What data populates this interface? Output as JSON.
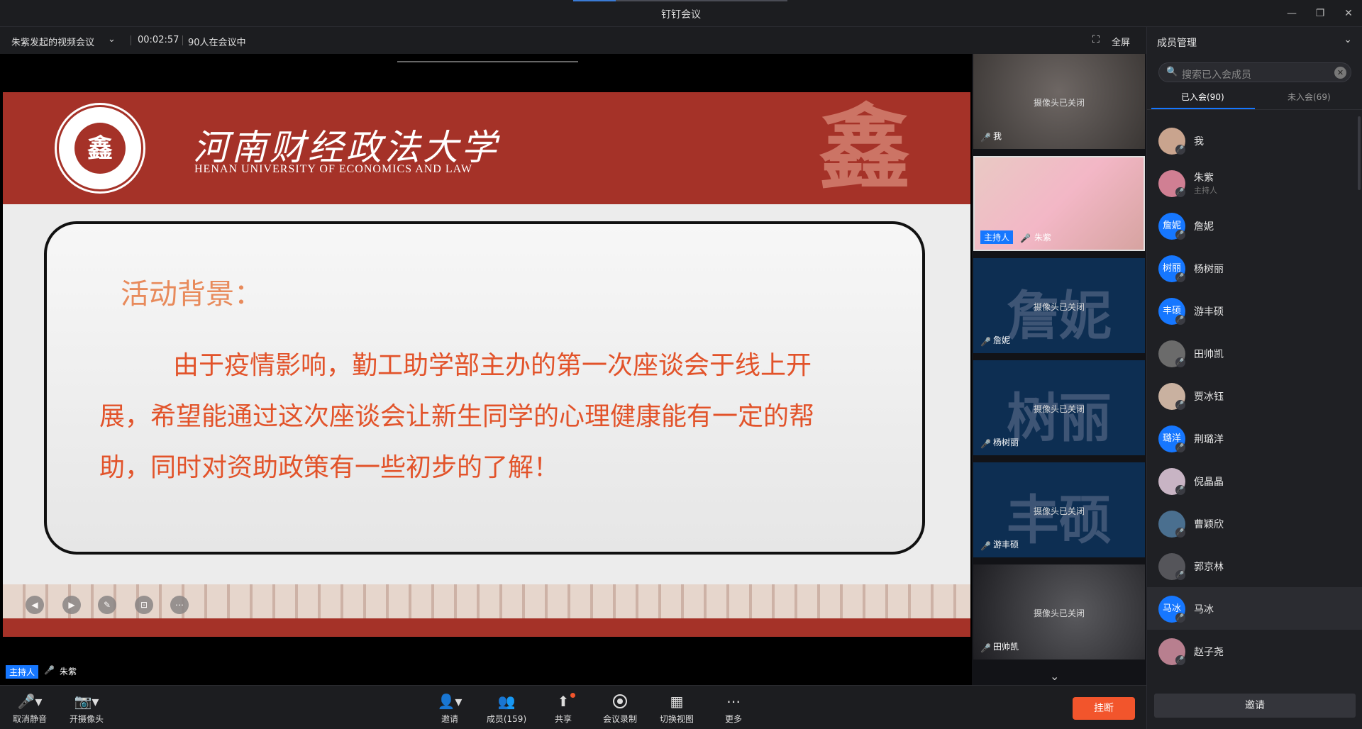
{
  "window": {
    "title": "钉钉会议"
  },
  "info": {
    "meeting_name": "朱紫发起的视频会议",
    "timer": "00:02:57",
    "participants": "90人在会议中",
    "fullscreen": "全屏"
  },
  "slide": {
    "university_cn": "河南财经政法大学",
    "university_en": "HENAN UNIVERSITY OF ECONOMICS AND LAW",
    "heading": "活动背景：",
    "body": "由于疫情影响，勤工助学部主办的第一次座谈会于线上开展，希望能通过这次座谈会让新生同学的心理健康能有一定的帮助，同时对资助政策有一些初步的了解！"
  },
  "speaker": {
    "host_tag": "主持人",
    "name": "朱紫"
  },
  "tiles": [
    {
      "name": "我",
      "status": "摄像头已关闭"
    },
    {
      "name": "朱紫",
      "tag": "主持人"
    },
    {
      "name": "詹妮",
      "status": "摄像头已关闭",
      "big": "詹妮"
    },
    {
      "name": "杨树丽",
      "status": "摄像头已关闭",
      "big": "树丽"
    },
    {
      "name": "游丰硕",
      "status": "摄像头已关闭",
      "big": "丰硕"
    },
    {
      "name": "田帅凯",
      "status": "摄像头已关闭"
    }
  ],
  "panel": {
    "title": "成员管理",
    "search_placeholder": "搜索已入会成员",
    "tab_joined": "已入会(90)",
    "tab_not_joined": "未入会(69)",
    "members": [
      {
        "name": "我",
        "avatar": "",
        "color": "#c9a48e"
      },
      {
        "name": "朱紫",
        "sub": "主持人",
        "avatar": "",
        "color": "#d07f93"
      },
      {
        "name": "詹妮",
        "avatar": "詹妮",
        "color": "#1677ff"
      },
      {
        "name": "杨树丽",
        "avatar": "树丽",
        "color": "#1677ff"
      },
      {
        "name": "游丰硕",
        "avatar": "丰硕",
        "color": "#1677ff"
      },
      {
        "name": "田帅凯",
        "avatar": "",
        "color": "#6b6b6b"
      },
      {
        "name": "贾冰钰",
        "avatar": "",
        "color": "#c9b1a0"
      },
      {
        "name": "荆璐洋",
        "avatar": "璐洋",
        "color": "#1677ff"
      },
      {
        "name": "倪晶晶",
        "avatar": "",
        "color": "#c8b4c4"
      },
      {
        "name": "曹颖欣",
        "avatar": "",
        "color": "#4a6f8f"
      },
      {
        "name": "郭京林",
        "avatar": "",
        "color": "#55555a"
      },
      {
        "name": "马冰",
        "avatar": "马冰",
        "color": "#1677ff"
      },
      {
        "name": "赵子尧",
        "avatar": "",
        "color": "#b87f8f"
      }
    ],
    "invite": "邀请"
  },
  "toolbar": {
    "unmute": "取消静音",
    "camera": "开摄像头",
    "invite": "邀请",
    "members": "成员(159)",
    "share": "共享",
    "record": "会议录制",
    "switch_view": "切换视图",
    "more": "更多",
    "hangup": "挂断"
  },
  "colors": {
    "accent": "#1677ff",
    "hangup": "#f2552c",
    "banner": "#a53228"
  }
}
